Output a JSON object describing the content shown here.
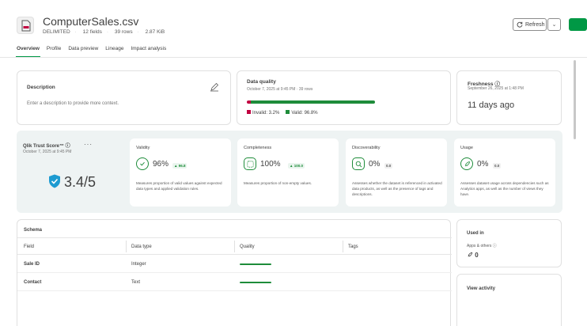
{
  "header": {
    "title": "ComputerSales.csv",
    "meta": {
      "format": "DELIMITED",
      "fields": "12 fields",
      "rows": "39 rows",
      "size": "2.87 KiB"
    },
    "refresh_label": "Refresh"
  },
  "tabs": [
    {
      "label": "Overview",
      "active": true
    },
    {
      "label": "Profile"
    },
    {
      "label": "Data preview"
    },
    {
      "label": "Lineage"
    },
    {
      "label": "Impact analysis"
    }
  ],
  "description": {
    "title": "Description",
    "placeholder": "Enter a description to provide more context."
  },
  "data_quality": {
    "title": "Data quality",
    "subtitle": "October 7, 2025 at 9:45 PM · 39 rows",
    "invalid_pct": 3.2,
    "valid_pct": 96.8,
    "invalid_label": "Invalid: 3.2%",
    "valid_label": "Valid: 96.8%",
    "invalid_color": "#c10040",
    "valid_color": "#1e8c3a"
  },
  "freshness": {
    "title": "Freshness ⓘ",
    "subtitle": "September 26, 2025 at 1:48 PM",
    "value": "11 days ago"
  },
  "trust_score": {
    "title": "Qlik Trust Score™ ⓘ",
    "date": "October 7, 2025 at 9:45 PM",
    "more": "···",
    "score": "3.4/5",
    "metrics": [
      {
        "title": "Validity",
        "value": "96%",
        "delta": "▲ 96.8",
        "desc": "Measures proportion of valid values against expected data types and applied validation rules."
      },
      {
        "title": "Completeness",
        "value": "100%",
        "delta": "▲ 100.0",
        "desc": "Measures proportion of non-empty values."
      },
      {
        "title": "Discoverability",
        "value": "0%",
        "delta": "0.0",
        "desc": "Assesses whether the dataset is referenced in activated data products, as well as the presence of tags and descriptions."
      },
      {
        "title": "Usage",
        "value": "0%",
        "delta": "0.0",
        "desc": "Assesses dataset usage across dependencies such as Analytics apps, as well as the number of views they have."
      }
    ]
  },
  "schema": {
    "title": "Schema",
    "columns": [
      "Field",
      "Data type",
      "Quality",
      "Tags"
    ],
    "rows": [
      {
        "field": "Sale ID",
        "type": "Integer",
        "quality": 1.0
      },
      {
        "field": "Contact",
        "type": "Text",
        "quality": 1.0
      }
    ]
  },
  "used_in": {
    "title": "Used in",
    "sub": "Apps & others ⓘ",
    "value": "0"
  },
  "activity": {
    "title": "View activity"
  },
  "colors": {
    "accent": "#009845",
    "panel": "#eef3f3"
  }
}
